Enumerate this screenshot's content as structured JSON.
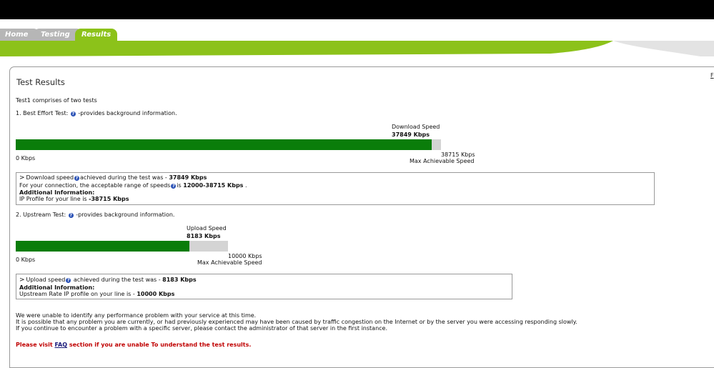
{
  "tabs": {
    "home": "Home",
    "testing": "Testing",
    "results": "Results"
  },
  "corner_link": "F",
  "title": "Test Results",
  "intro": "Test1 comprises of two tests",
  "test1": {
    "heading": "1. Best Effort Test:",
    "heading_suffix": " -provides background information.",
    "speed_label": "Download Speed",
    "speed_value": "37849 Kbps",
    "min_label": "0 Kbps",
    "max_value": "38715 Kbps",
    "max_label": "Max Achievable Speed",
    "fraction": 0.9776,
    "info": {
      "line1_a": "Download speed",
      "line1_b": "achieved during the test was - ",
      "line1_value": "37849 Kbps",
      "line2_a": "For your connection, the acceptable range of speeds",
      "line2_b": "is ",
      "line2_value": "12000-38715 Kbps",
      "line2_end": " .",
      "additional": "Additional Information:",
      "line4_a": "IP Profile for your line is ",
      "line4_value": "-38715 Kbps"
    }
  },
  "test2": {
    "heading": "2. Upstream Test:",
    "heading_suffix": " -provides background information.",
    "speed_label": "Upload Speed",
    "speed_value": "8183 Kbps",
    "min_label": "0 Kbps",
    "max_value": "10000 Kbps",
    "max_label": "Max Achievable Speed",
    "fraction": 0.8183,
    "info": {
      "line1_a": "Upload speed",
      "line1_b": " achieved during the test was - ",
      "line1_value": "8183 Kbps",
      "additional": "Additional Information:",
      "line3_a": "Upstream Rate IP profile on your line is - ",
      "line3_value": "10000 Kbps"
    }
  },
  "summary": {
    "line1": "We were unable to identify any performance problem with your service at this time.",
    "line2": "It is possible that any problem you are currently, or had previously experienced may have been caused by traffic congestion on the Internet or by the server you were accessing responding slowly.",
    "line3": "If you continue to encounter a problem with a specific server, please contact the administrator of that server in the first instance."
  },
  "faq_note": {
    "prefix": "Please visit ",
    "link": "FAQ",
    "suffix": " section if you are unable To understand the test results."
  },
  "colors": {
    "accent": "#8cc21a",
    "bar_fill": "#0a7d0a",
    "bar_track": "#d4d4d4",
    "alert": "#c00000"
  }
}
